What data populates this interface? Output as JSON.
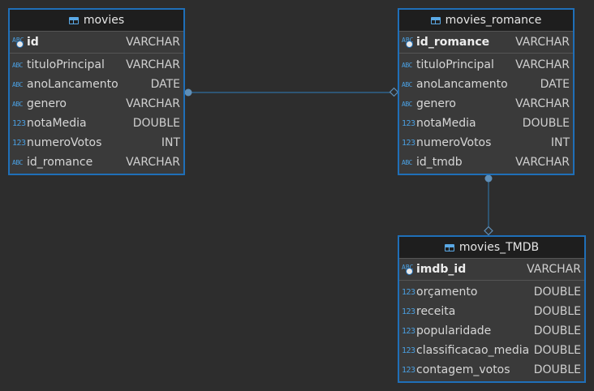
{
  "tables": {
    "movies": {
      "title": "movies",
      "pk": {
        "name": "id",
        "type": "VARCHAR",
        "icon": "abc"
      },
      "columns": [
        {
          "name": "tituloPrincipal",
          "type": "VARCHAR",
          "icon": "abc"
        },
        {
          "name": "anoLancamento",
          "type": "DATE",
          "icon": "abc"
        },
        {
          "name": "genero",
          "type": "VARCHAR",
          "icon": "abc"
        },
        {
          "name": "notaMedia",
          "type": "DOUBLE",
          "icon": "123"
        },
        {
          "name": "numeroVotos",
          "type": "INT",
          "icon": "123"
        },
        {
          "name": "id_romance",
          "type": "VARCHAR",
          "icon": "abc"
        }
      ]
    },
    "movies_romance": {
      "title": "movies_romance",
      "pk": {
        "name": "id_romance",
        "type": "VARCHAR",
        "icon": "abc"
      },
      "columns": [
        {
          "name": "tituloPrincipal",
          "type": "VARCHAR",
          "icon": "abc"
        },
        {
          "name": "anoLancamento",
          "type": "DATE",
          "icon": "abc"
        },
        {
          "name": "genero",
          "type": "VARCHAR",
          "icon": "abc"
        },
        {
          "name": "notaMedia",
          "type": "DOUBLE",
          "icon": "123"
        },
        {
          "name": "numeroVotos",
          "type": "INT",
          "icon": "123"
        },
        {
          "name": "id_tmdb",
          "type": "VARCHAR",
          "icon": "abc"
        }
      ]
    },
    "movies_tmdb": {
      "title": "movies_TMDB",
      "pk": {
        "name": "imdb_id",
        "type": "VARCHAR",
        "icon": "abc"
      },
      "columns": [
        {
          "name": "orçamento",
          "type": "DOUBLE",
          "icon": "123"
        },
        {
          "name": "receita",
          "type": "DOUBLE",
          "icon": "123"
        },
        {
          "name": "popularidade",
          "type": "DOUBLE",
          "icon": "123"
        },
        {
          "name": "classificacao_media",
          "type": "DOUBLE",
          "icon": "123"
        },
        {
          "name": "contagem_votos",
          "type": "DOUBLE",
          "icon": "123"
        }
      ]
    }
  },
  "icons": {
    "abc": "ABC",
    "123": "123"
  },
  "colors": {
    "border": "#1f6fb8",
    "icon": "#4a9fe0",
    "link": "#2f6e9e",
    "background": "#2d2d2d"
  }
}
